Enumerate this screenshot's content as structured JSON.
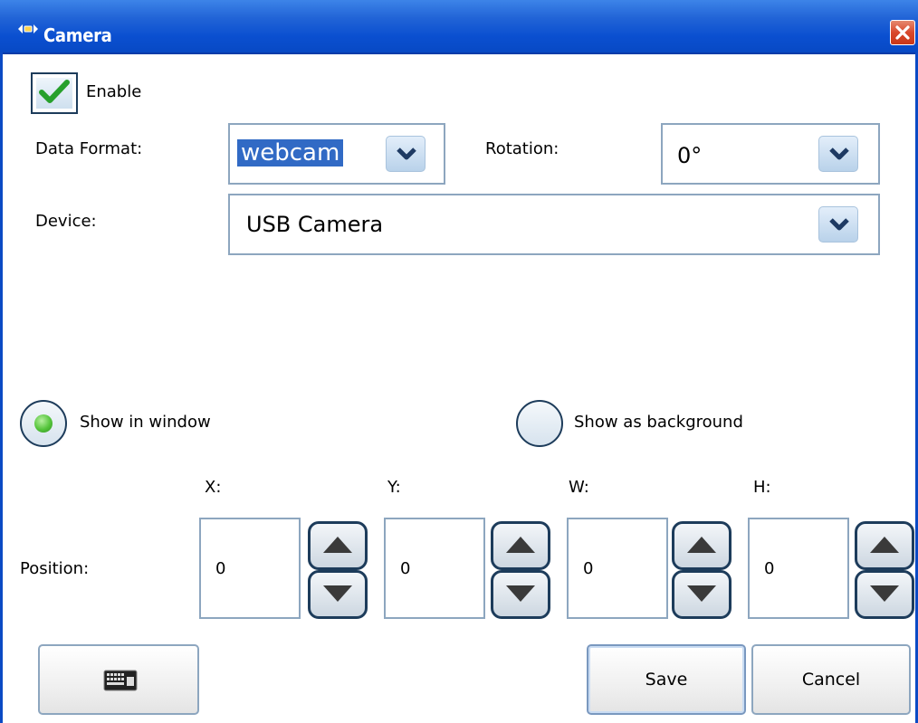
{
  "window": {
    "title": "Camera",
    "accent_color": "#0a4fd0",
    "close_icon": "close-icon"
  },
  "enable": {
    "label": "Enable",
    "checked": true
  },
  "data_format": {
    "label": "Data Format:",
    "value": "webcam"
  },
  "rotation": {
    "label": "Rotation:",
    "value": "0°"
  },
  "device": {
    "label": "Device:",
    "value": "USB Camera"
  },
  "display_mode": {
    "options": [
      {
        "label": "Show in window",
        "selected": true
      },
      {
        "label": "Show as background",
        "selected": false
      }
    ]
  },
  "position": {
    "label": "Position:",
    "fields": [
      {
        "label": "X:",
        "value": "0"
      },
      {
        "label": "Y:",
        "value": "0"
      },
      {
        "label": "W:",
        "value": "0"
      },
      {
        "label": "H:",
        "value": "0"
      }
    ]
  },
  "footer": {
    "keyboard_icon": "keyboard-icon",
    "save_label": "Save",
    "cancel_label": "Cancel"
  }
}
